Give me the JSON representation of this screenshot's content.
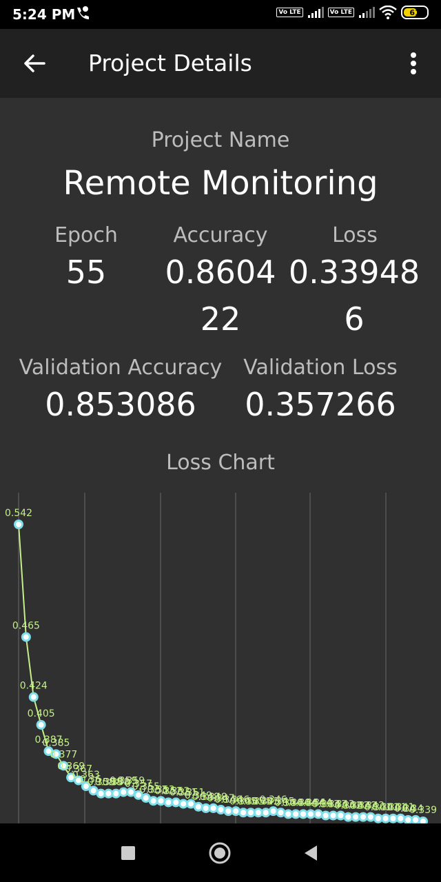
{
  "status_bar": {
    "time": "5:24 PM",
    "battery": "61",
    "volte": "Vo LTE"
  },
  "app_bar": {
    "title": "Project Details",
    "back_icon": "arrow-back-icon",
    "menu_icon": "more-vert-icon"
  },
  "project": {
    "name_label": "Project Name",
    "name": "Remote Monitoring"
  },
  "stats": {
    "epoch_label": "Epoch",
    "epoch": "55",
    "accuracy_label": "Accuracy",
    "accuracy_line1": "0.8604",
    "accuracy_line2": "22",
    "loss_label": "Loss",
    "loss_line1": "0.33948",
    "loss_line2": "6",
    "val_accuracy_label": "Validation Accuracy",
    "val_accuracy": "0.853086",
    "val_loss_label": "Validation Loss",
    "val_loss": "0.357266"
  },
  "chart_title": "Loss Chart",
  "colors": {
    "line": "#c5f08a",
    "point": "#80deea",
    "grid": "#6a6a6a"
  },
  "chart_data": {
    "type": "line",
    "title": "Loss Chart",
    "grid": true,
    "series": [
      {
        "values": [
          0.542,
          0.465,
          0.424,
          0.405,
          0.387,
          0.385,
          0.377,
          0.369,
          0.367,
          0.363,
          0.36,
          0.358,
          0.358,
          0.358,
          0.359,
          0.359,
          0.357,
          0.355,
          0.353,
          0.353,
          0.352,
          0.352,
          0.351,
          0.351,
          0.349,
          0.348,
          0.348,
          0.347,
          0.346,
          0.346,
          0.345,
          0.345,
          0.345,
          0.345,
          0.346,
          0.345,
          0.344,
          0.344,
          0.344,
          0.344,
          0.344,
          0.343,
          0.343,
          0.343,
          0.342,
          0.342,
          0.342,
          0.342,
          0.341,
          0.341,
          0.341,
          0.341,
          0.34,
          0.34,
          0.339
        ]
      }
    ]
  }
}
